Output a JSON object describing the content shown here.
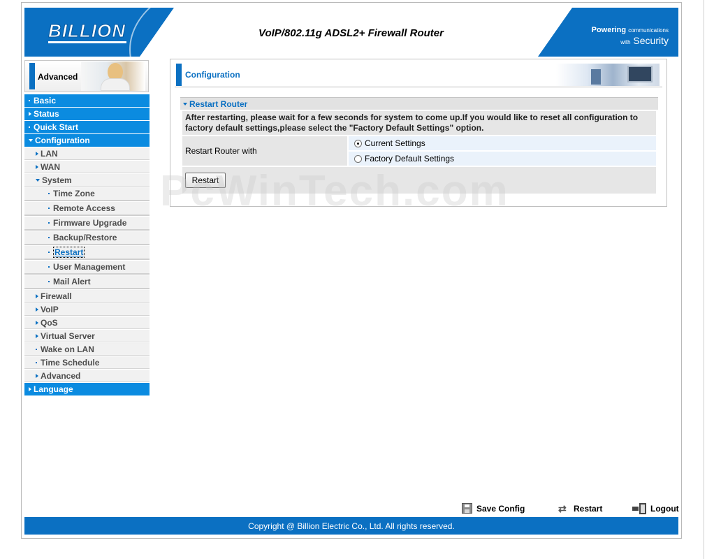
{
  "header": {
    "logo": "BILLION",
    "product_title": "VoIP/802.11g ADSL2+ Firewall Router",
    "tagline_line1_a": "Powering",
    "tagline_line1_b": "communications",
    "tagline_line2_a": "with",
    "tagline_line2_b": "Security"
  },
  "sidebar": {
    "mode_label": "Advanced",
    "items": [
      {
        "label": "Basic",
        "level": "top",
        "icon": "dot"
      },
      {
        "label": "Status",
        "level": "top",
        "icon": "arrow-right"
      },
      {
        "label": "Quick Start",
        "level": "top",
        "icon": "dot"
      },
      {
        "label": "Configuration",
        "level": "top",
        "icon": "arrow-down",
        "expanded": true
      },
      {
        "label": "LAN",
        "level": "sub",
        "icon": "arrow-right"
      },
      {
        "label": "WAN",
        "level": "sub",
        "icon": "arrow-right"
      },
      {
        "label": "System",
        "level": "sub",
        "icon": "arrow-down",
        "expanded": true
      },
      {
        "label": "Time Zone",
        "level": "sub2",
        "icon": "dot"
      },
      {
        "label": "Remote Access",
        "level": "sub2",
        "icon": "dot"
      },
      {
        "label": "Firmware Upgrade",
        "level": "sub2",
        "icon": "dot"
      },
      {
        "label": "Backup/Restore",
        "level": "sub2",
        "icon": "dot"
      },
      {
        "label": "Restart",
        "level": "sub2",
        "icon": "dot",
        "active": true
      },
      {
        "label": "User Management",
        "level": "sub2",
        "icon": "dot"
      },
      {
        "label": "Mail Alert",
        "level": "sub2",
        "icon": "dot"
      },
      {
        "label": "Firewall",
        "level": "sub",
        "icon": "arrow-right"
      },
      {
        "label": "VoIP",
        "level": "sub",
        "icon": "arrow-right"
      },
      {
        "label": "QoS",
        "level": "sub",
        "icon": "arrow-right"
      },
      {
        "label": "Virtual Server",
        "level": "sub",
        "icon": "arrow-right"
      },
      {
        "label": "Wake on LAN",
        "level": "sub",
        "icon": "dot"
      },
      {
        "label": "Time Schedule",
        "level": "sub",
        "icon": "dot"
      },
      {
        "label": "Advanced",
        "level": "sub",
        "icon": "arrow-right"
      },
      {
        "label": "Language",
        "level": "top",
        "icon": "arrow-right"
      }
    ]
  },
  "content": {
    "page_title": "Configuration",
    "section_title": "Restart Router",
    "notice": "After restarting, please wait for a few seconds for system to come up.If you would like to reset all configuration to factory default settings,please select the \"Factory Default Settings\" option.",
    "row_label": "Restart Router with",
    "options": [
      {
        "label": "Current Settings",
        "selected": true
      },
      {
        "label": "Factory Default Settings",
        "selected": false
      }
    ],
    "restart_button": "Restart"
  },
  "watermark": "PcWinTech.com",
  "actions": {
    "save_config": "Save Config",
    "restart": "Restart",
    "logout": "Logout"
  },
  "footer": {
    "copyright": "Copyright @ Billion Electric Co., Ltd. All rights reserved."
  },
  "colors": {
    "brand_blue": "#0b70c2",
    "menu_blue": "#0b8be0"
  }
}
